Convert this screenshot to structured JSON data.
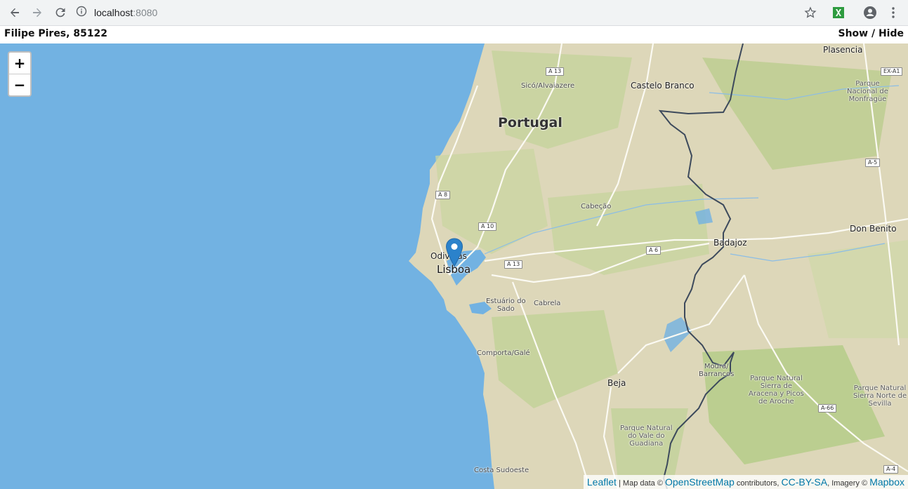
{
  "browser": {
    "url_host": "localhost",
    "url_port": ":8080",
    "icons": [
      "back-arrow-icon",
      "forward-arrow-icon",
      "reload-icon",
      "info-icon",
      "star-icon",
      "extension-icon",
      "account-icon",
      "menu-dots-icon"
    ]
  },
  "header": {
    "title": "Filipe Pires, 85122",
    "toggle_label": "Show / Hide"
  },
  "map": {
    "zoom_in": "+",
    "zoom_out": "−",
    "labels": {
      "plasencia": "Plasencia",
      "sico": "Sicó/Alvaiazere",
      "castelo": "Castelo Branco",
      "portugal": "Portugal",
      "parque_monfrague": "Parque\nNacional de\nMonfragüe",
      "cabecao": "Cabeção",
      "don_benito": "Don Benito",
      "badajoz": "Badajoz",
      "odivelas": "Odivelas",
      "lisboa": "Lisboa",
      "estuario": "Estuário do\nSado",
      "cabrela": "Cabrela",
      "comporta": "Comporta/Galé",
      "moura": "Moura/\nBarrancos",
      "parque_aracena": "Parque Natural\nSierra de\nAracena y Picos\nde Aroche",
      "beja": "Beja",
      "parque_sevilla": "Parque Natural\nSierra Norte de\nSevilla",
      "parque_guadiana": "Parque Natural\ndo Vale do\nGuadiana",
      "costa": "Costa Sudoeste"
    },
    "roads": {
      "a13_top": "A 13",
      "exa1": "EX-A1",
      "a5": "A-5",
      "a8": "A 8",
      "a10": "A 10",
      "a6": "A 6",
      "a13_mid": "A 13",
      "a66": "A-66",
      "a4": "A-4"
    },
    "marker": "map-pin-icon"
  },
  "attribution": {
    "leaflet": "Leaflet",
    "sep1": " | Map data © ",
    "osm": "OpenStreetMap",
    "contrib": " contributors, ",
    "ccbysa": "CC-BY-SA",
    "imagery": ", Imagery © ",
    "mapbox": "Mapbox"
  },
  "colors": {
    "water": "#72b2e2",
    "land": "#ddd7b9",
    "vegetation": "#b9cf92",
    "border": "#3d4a5c",
    "link": "#0078a8",
    "marker": "#2b82cb"
  }
}
